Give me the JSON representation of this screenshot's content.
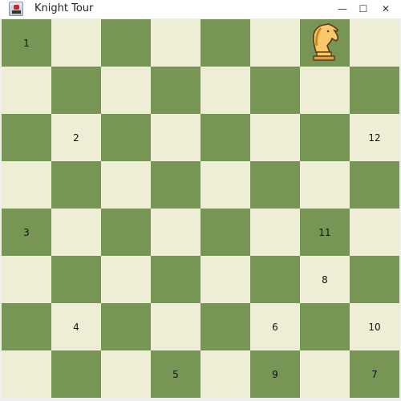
{
  "window": {
    "title": "Knight Tour",
    "icon": "java-app-icon",
    "controls": {
      "minimize": "—",
      "maximize": "☐",
      "close": "✕"
    }
  },
  "colors": {
    "dark_square": "#779555",
    "light_square": "#eeeed6",
    "knight_fill": "#f8c86a",
    "knight_outline": "#5a3a10"
  },
  "board": {
    "rows": 8,
    "cols": 8,
    "knight": {
      "row": 0,
      "col": 6
    },
    "moves": [
      {
        "n": "1",
        "row": 0,
        "col": 0
      },
      {
        "n": "2",
        "row": 2,
        "col": 1
      },
      {
        "n": "3",
        "row": 4,
        "col": 0
      },
      {
        "n": "4",
        "row": 6,
        "col": 1
      },
      {
        "n": "5",
        "row": 7,
        "col": 3
      },
      {
        "n": "6",
        "row": 6,
        "col": 5
      },
      {
        "n": "7",
        "row": 7,
        "col": 7
      },
      {
        "n": "8",
        "row": 5,
        "col": 6
      },
      {
        "n": "9",
        "row": 7,
        "col": 5
      },
      {
        "n": "10",
        "row": 6,
        "col": 7
      },
      {
        "n": "11",
        "row": 4,
        "col": 6
      },
      {
        "n": "12",
        "row": 2,
        "col": 7
      }
    ]
  }
}
